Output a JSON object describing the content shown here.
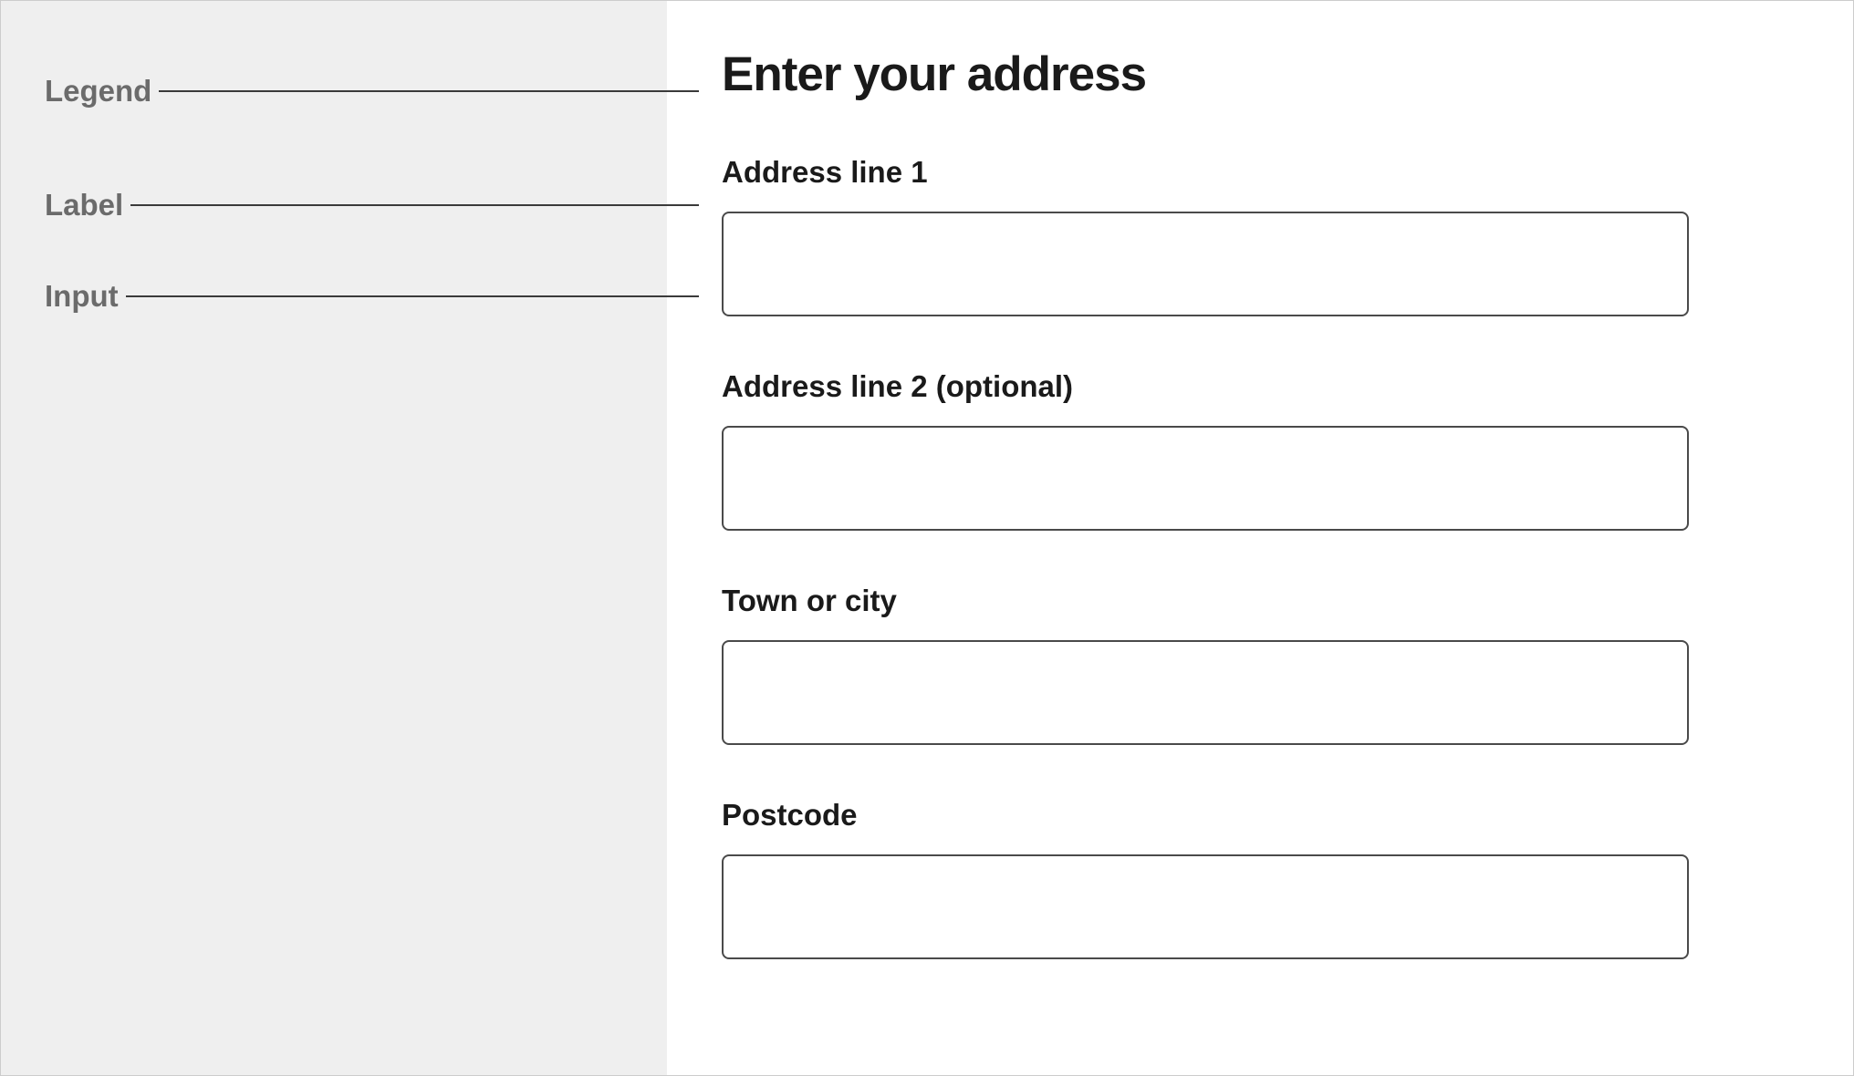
{
  "annotations": {
    "legend": "Legend",
    "label": "Label",
    "input": "Input"
  },
  "form": {
    "legend": "Enter your address",
    "fields": [
      {
        "label": "Address line 1",
        "value": ""
      },
      {
        "label": "Address line 2 (optional)",
        "value": ""
      },
      {
        "label": "Town or city",
        "value": ""
      },
      {
        "label": "Postcode",
        "value": ""
      }
    ]
  }
}
